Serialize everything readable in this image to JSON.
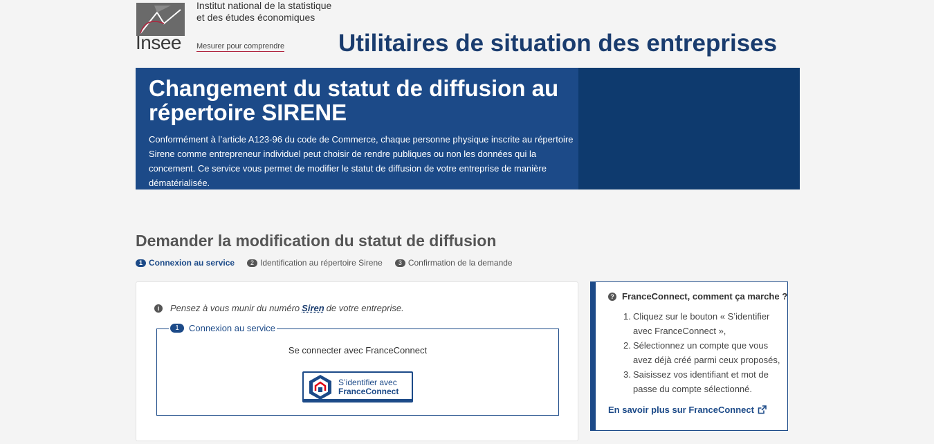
{
  "header": {
    "logo_word": "Insee",
    "institute_line1": "Institut national de la statistique",
    "institute_line2": "et des études économiques",
    "motto": "Mesurer pour comprendre",
    "site_title": "Utilitaires de situation des entreprises"
  },
  "banner": {
    "title": "Changement du statut de diffusion au répertoire SIRENE",
    "text": "Conformément à l’article A123-96 du code de Commerce, chaque personne physique inscrite au répertoire Sirene comme entrepreneur individuel peut choisir de rendre publiques ou non les données qui la concement. Ce service vous permet de modifier le statut de diffusion de votre entreprise de manière dématérialisée."
  },
  "main": {
    "section_title": "Demander la modification du statut de diffusion",
    "steps": [
      {
        "num": "1",
        "label": "Connexion au service"
      },
      {
        "num": "2",
        "label": "Identification au répertoire Sirene"
      },
      {
        "num": "3",
        "label": "Confirmation de la demande"
      }
    ],
    "notice_before": "Pensez à vous munir du numéro",
    "notice_link": "Siren",
    "notice_after": "de votre entreprise.",
    "fieldset_num": "1",
    "fieldset_legend": "Connexion au service",
    "connect_text": "Se connecter avec FranceConnect",
    "fc_button_line1": "S’identifier avec",
    "fc_button_line2": "FranceConnect"
  },
  "aside": {
    "title": "FranceConnect, comment ça marche ?",
    "items": [
      {
        "num": "1.",
        "text": "Cliquez sur le bouton « S’identifier avec FranceConnect »,"
      },
      {
        "num": "2.",
        "text": "Sélectionnez un compte que vous avez déjà créé parmi ceux proposés,"
      },
      {
        "num": "3.",
        "text": "Saisissez vos identifiant et mot de passe du compte sélectionné."
      }
    ],
    "link": "En savoir plus sur FranceConnect"
  },
  "colors": {
    "primary_blue": "#1c4a88",
    "banner_dark": "#0e3a6e",
    "accent_red": "#b0243d"
  },
  "icons": [
    "insee-logo",
    "info-icon",
    "question-icon",
    "external-link-icon",
    "franceconnect-logo"
  ]
}
